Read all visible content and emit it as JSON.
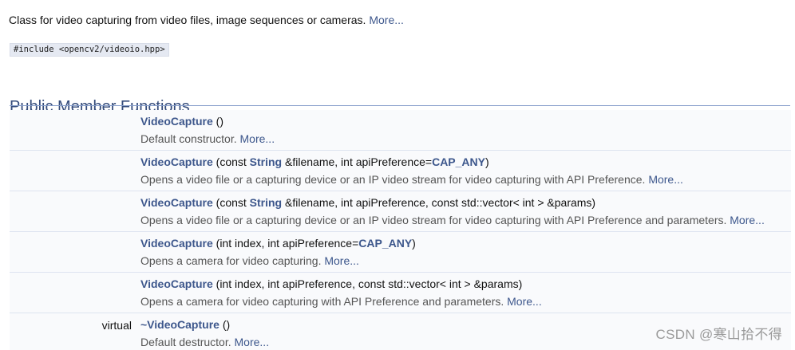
{
  "brief": {
    "text": "Class for video capturing from video files, image sequences or cameras. ",
    "more": "More..."
  },
  "include": "#include <opencv2/videoio.hpp>",
  "section_title": "Public Member Functions",
  "members": [
    {
      "qualifier": "",
      "name": "VideoCapture",
      "sig_parts": [
        {
          "t": " ()",
          "k": "plain"
        }
      ],
      "desc": "Default constructor. ",
      "more": "More..."
    },
    {
      "qualifier": "",
      "name": "VideoCapture",
      "sig_parts": [
        {
          "t": " (const ",
          "k": "plain"
        },
        {
          "t": "String",
          "k": "type"
        },
        {
          "t": " &filename, int apiPreference=",
          "k": "plain"
        },
        {
          "t": "CAP_ANY",
          "k": "type"
        },
        {
          "t": ")",
          "k": "plain"
        }
      ],
      "desc": "Opens a video file or a capturing device or an IP video stream for video capturing with API Preference. ",
      "more": "More..."
    },
    {
      "qualifier": "",
      "name": "VideoCapture",
      "sig_parts": [
        {
          "t": " (const ",
          "k": "plain"
        },
        {
          "t": "String",
          "k": "type"
        },
        {
          "t": " &filename, int apiPreference, const std::vector< int > &params)",
          "k": "plain"
        }
      ],
      "desc": "Opens a video file or a capturing device or an IP video stream for video capturing with API Preference and parameters. ",
      "more": "More..."
    },
    {
      "qualifier": "",
      "name": "VideoCapture",
      "sig_parts": [
        {
          "t": " (int index, int apiPreference=",
          "k": "plain"
        },
        {
          "t": "CAP_ANY",
          "k": "type"
        },
        {
          "t": ")",
          "k": "plain"
        }
      ],
      "desc": "Opens a camera for video capturing. ",
      "more": "More..."
    },
    {
      "qualifier": "",
      "name": "VideoCapture",
      "sig_parts": [
        {
          "t": " (int index, int apiPreference, const std::vector< int > &params)",
          "k": "plain"
        }
      ],
      "desc": "Opens a camera for video capturing with API Preference and parameters. ",
      "more": "More..."
    },
    {
      "qualifier": "virtual",
      "name": "~VideoCapture",
      "sig_parts": [
        {
          "t": " ()",
          "k": "plain"
        }
      ],
      "desc": "Default destructor. ",
      "more": "More..."
    }
  ],
  "watermark": "CSDN @寒山拾不得"
}
